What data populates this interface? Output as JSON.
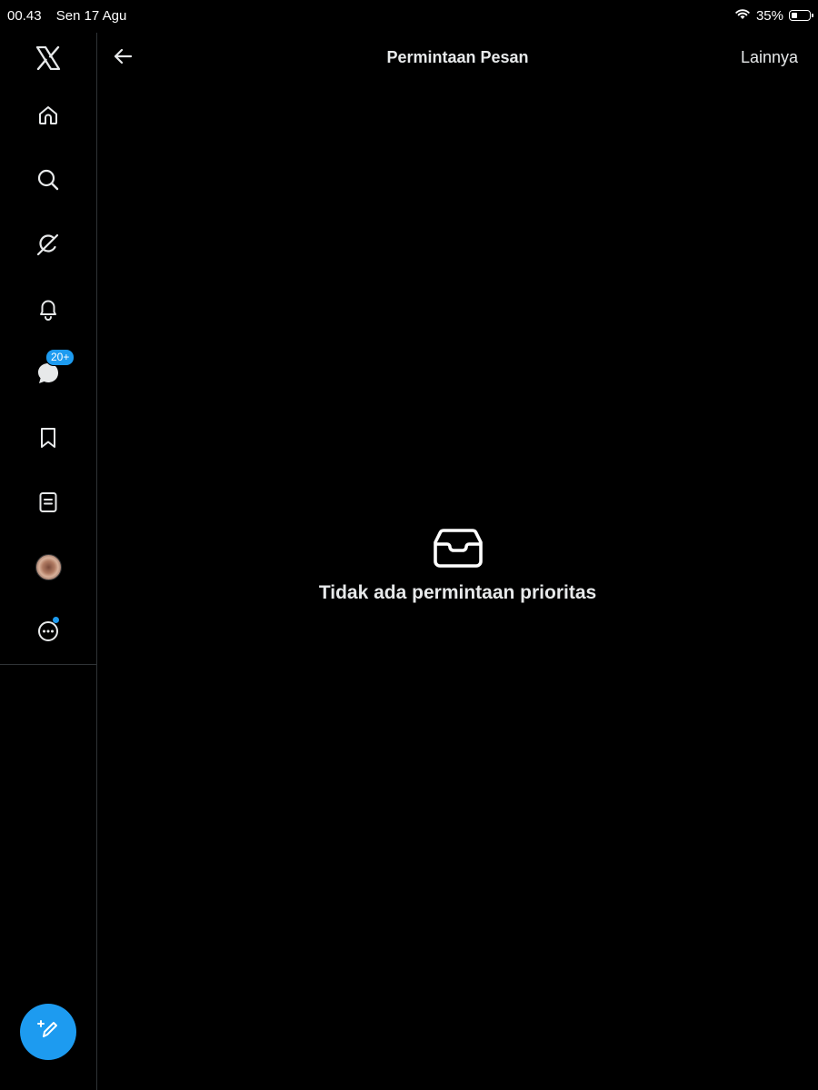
{
  "status_bar": {
    "time": "00.43",
    "date": "Sen 17 Agu",
    "battery_percent": "35%",
    "battery_level": 0.35,
    "wifi_icon": "wifi-icon"
  },
  "sidebar": {
    "items": [
      {
        "name": "x-logo",
        "icon": "x-logo-icon"
      },
      {
        "name": "home",
        "icon": "home-icon"
      },
      {
        "name": "search",
        "icon": "search-icon"
      },
      {
        "name": "grok",
        "icon": "grok-icon"
      },
      {
        "name": "notifications",
        "icon": "bell-icon"
      },
      {
        "name": "messages",
        "icon": "message-icon",
        "badge": "20+"
      },
      {
        "name": "bookmarks",
        "icon": "bookmark-icon"
      },
      {
        "name": "lists",
        "icon": "list-icon"
      },
      {
        "name": "profile",
        "icon": "avatar"
      },
      {
        "name": "more",
        "icon": "more-icon",
        "has_dot": true
      }
    ],
    "compose_icon": "compose-icon"
  },
  "header": {
    "title": "Permintaan Pesan",
    "more_label": "Lainnya",
    "back_icon": "back-arrow-icon"
  },
  "main": {
    "empty_icon": "inbox-icon",
    "empty_text": "Tidak ada permintaan prioritas"
  },
  "colors": {
    "background": "#000000",
    "accent": "#1d9bf0",
    "text": "#e7e9ea",
    "divider": "#2f3336"
  }
}
